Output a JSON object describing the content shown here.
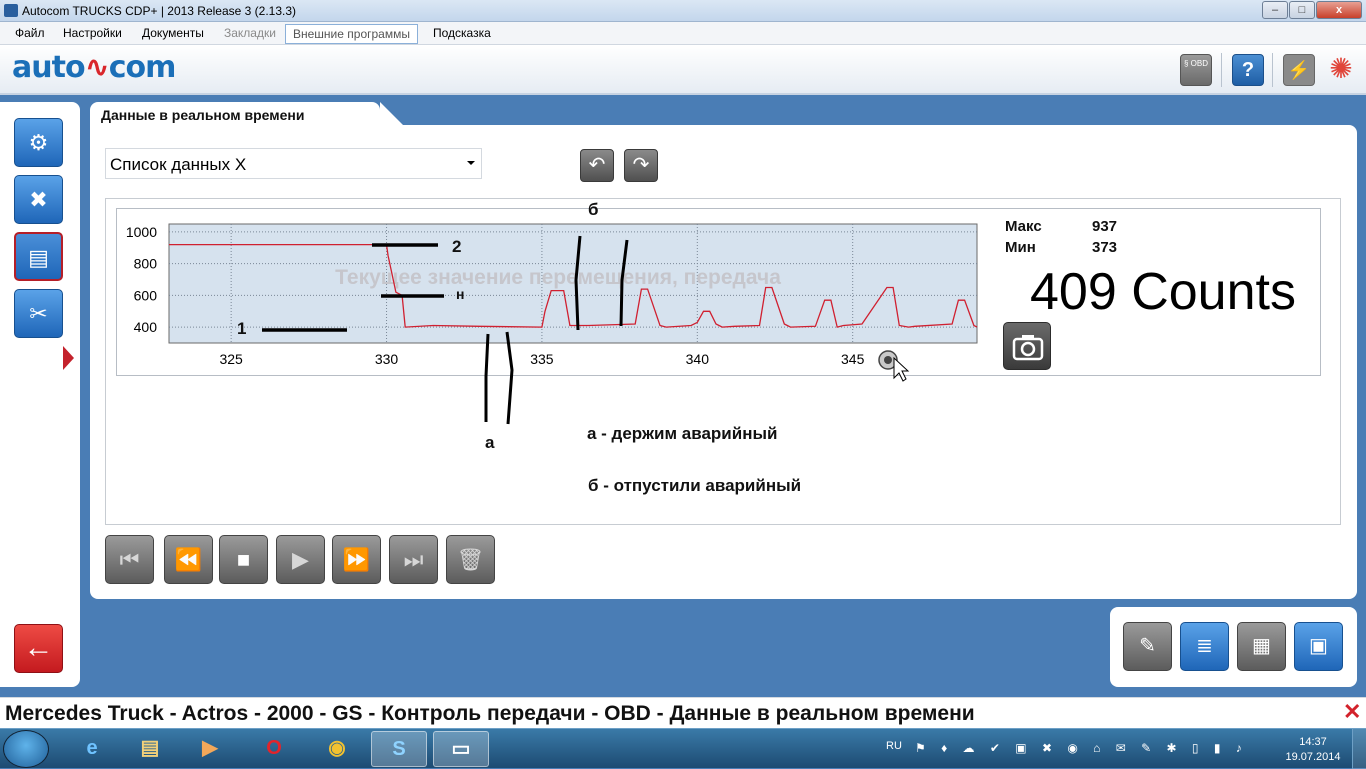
{
  "window": {
    "title": "Autocom TRUCKS CDP+ | 2013 Release 3 (2.13.3)",
    "buttons": {
      "minimize": "–",
      "maximize": "□",
      "close": "x"
    }
  },
  "menu": [
    "Файл",
    "Настройки",
    "Документы",
    "Закладки",
    "Внешние программы",
    "Подсказка"
  ],
  "logo": {
    "text_before": "auto",
    "pulse": "∿",
    "text_after": "com"
  },
  "header_icons": [
    "obd-icon",
    "help-icon",
    "battery-icon",
    "spinner-icon"
  ],
  "header_text": {
    "obd": "§ OBD",
    "help": "?"
  },
  "left_nav": [
    "engine-icon",
    "clear-dtc-icon",
    "live-data-icon",
    "tools-icon",
    "back-icon"
  ],
  "tab": {
    "label": "Данные в реальном времени"
  },
  "dropdown": {
    "value": "Список данных X"
  },
  "nav_arrows": {
    "prev": "↶",
    "next": "↷"
  },
  "stats": {
    "max_label": "Макс",
    "max_value": "937",
    "min_label": "Мин",
    "min_value": "373"
  },
  "current_value": "409 Counts",
  "chart_data": {
    "type": "line",
    "title": "Текущее значение перемещения, передача",
    "xlim": [
      323,
      349
    ],
    "ylim": [
      300,
      1050
    ],
    "x_ticks": [
      325,
      330,
      335,
      340,
      345
    ],
    "y_ticks": [
      400,
      600,
      800,
      1000
    ],
    "grid": true,
    "color": "#d02030",
    "x": [
      323.0,
      330.0,
      330.05,
      330.3,
      330.5,
      330.6,
      331.5,
      333.0,
      335.0,
      335.1,
      335.3,
      335.7,
      335.9,
      336.5,
      338.0,
      338.2,
      338.4,
      338.8,
      339.0,
      339.8,
      340.0,
      340.2,
      340.4,
      340.6,
      340.8,
      341.2,
      342.0,
      342.2,
      342.4,
      342.8,
      343.0,
      343.8,
      344.1,
      344.3,
      344.5,
      344.7,
      345.3,
      346.1,
      346.3,
      346.5,
      346.8,
      347.0,
      348.2,
      348.4,
      348.6,
      348.9,
      349.0
    ],
    "y": [
      920,
      920,
      850,
      620,
      600,
      400,
      410,
      405,
      400,
      500,
      630,
      630,
      410,
      410,
      420,
      640,
      640,
      410,
      400,
      410,
      430,
      500,
      500,
      420,
      400,
      405,
      410,
      650,
      650,
      420,
      400,
      405,
      570,
      570,
      400,
      410,
      420,
      650,
      650,
      410,
      400,
      405,
      420,
      570,
      570,
      410,
      400
    ]
  },
  "annotations": {
    "line1": "1",
    "line2": "2",
    "line_n": "н",
    "label_a": "а",
    "label_b": "б",
    "legend_a": "а - держим аварийный",
    "legend_b": "б - отпустили аварийный"
  },
  "player": [
    "first-icon",
    "rewind-icon",
    "stop-icon",
    "play-icon",
    "fast-forward-icon",
    "last-icon",
    "delete-icon"
  ],
  "player_glyphs": [
    "⏮",
    "⏪",
    "■",
    "▶",
    "⏩",
    "⏭",
    "🗑"
  ],
  "right_tools": [
    "clear-memory-icon",
    "list-icon",
    "ecu-icon",
    "ecu-connect-icon"
  ],
  "right_glyphs": [
    "✎",
    "≣",
    "▦",
    "▣"
  ],
  "status_bar": {
    "text": "Mercedes Truck - Actros - 2000 - GS - Контроль передачи - OBD - Данные в реальном времени",
    "close": "✕"
  },
  "taskbar": {
    "apps": [
      "ie-icon",
      "explorer-icon",
      "media-icon",
      "opera-icon",
      "chrome-icon",
      "skype-icon",
      "autocom-icon"
    ],
    "app_glyphs": [
      "e",
      "▤",
      "▶",
      "O",
      "◉",
      "S",
      "▭"
    ],
    "lang": "RU",
    "tray": "⚑ ♦ ☁ ✔ ▣ ✖ ◉ ⌂ ✉ ✎ ✱ ▯ ▮ ♪",
    "time": "14:37",
    "date": "19.07.2014"
  }
}
